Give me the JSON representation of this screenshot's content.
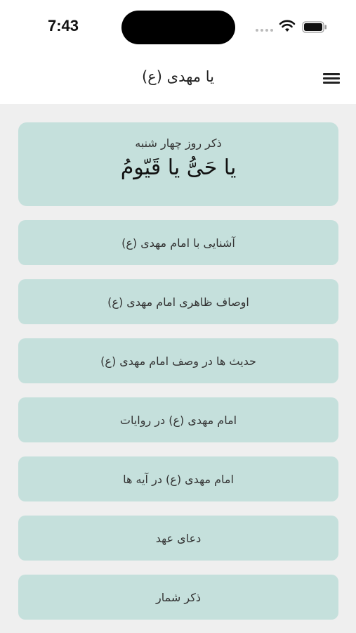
{
  "status_bar": {
    "time": "7:43"
  },
  "header": {
    "title": "یا مهدی (ع)",
    "menu_icon": "hamburger-menu-icon"
  },
  "zekr_card": {
    "label": "ذکر روز چهار شنبه",
    "text": "یا حَیُّ یا قَیّومُ"
  },
  "menu": {
    "items": [
      {
        "label": "آشنایی با امام مهدی (ع)"
      },
      {
        "label": "اوصاف ظاهری امام مهدی (ع)"
      },
      {
        "label": "حدیث ها در وصف امام مهدی (ع)"
      },
      {
        "label": "امام مهدی (ع) در روایات"
      },
      {
        "label": "امام مهدی (ع) در آیه ها"
      },
      {
        "label": "دعای عهد"
      },
      {
        "label": "ذکر شمار"
      }
    ]
  },
  "colors": {
    "card_background": "#c5e0dc",
    "page_background": "#efefef",
    "header_background": "#ffffff"
  }
}
